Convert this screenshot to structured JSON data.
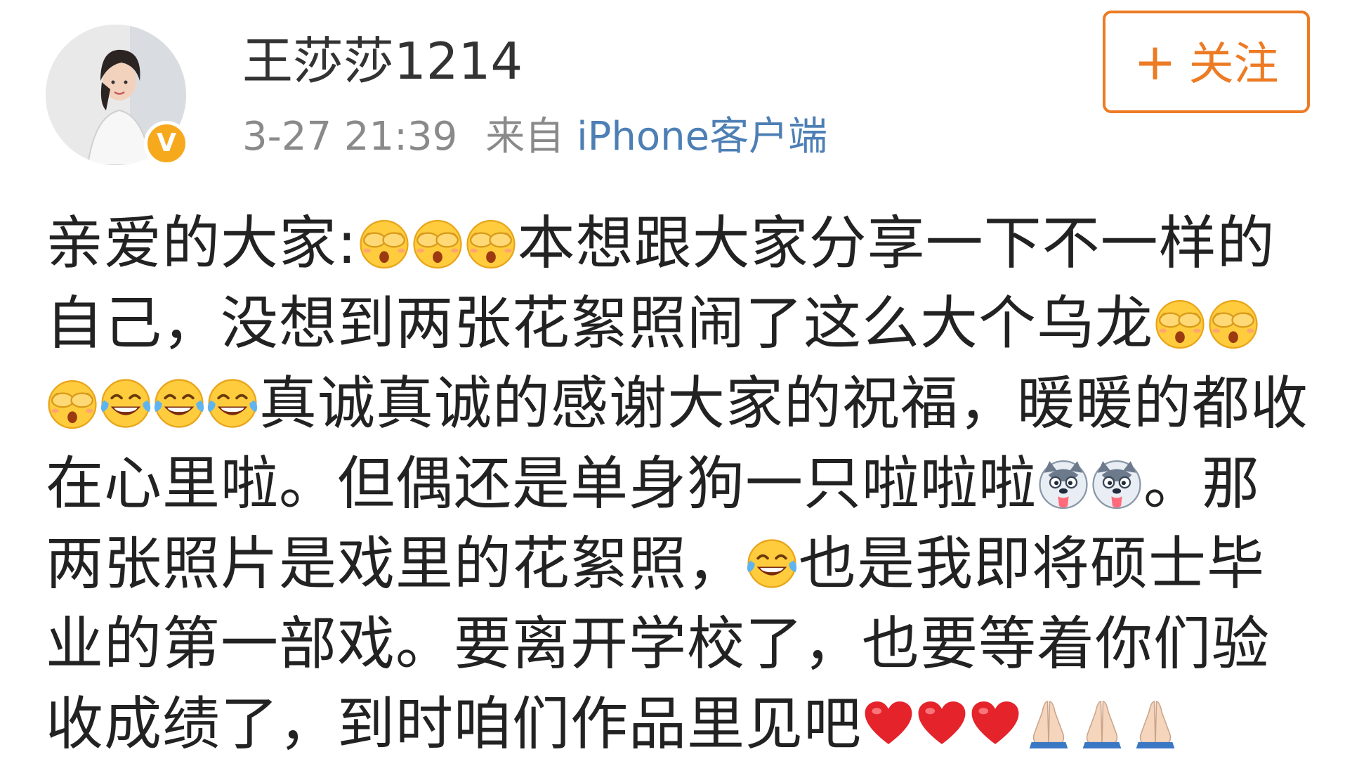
{
  "post": {
    "author": {
      "username": "王莎莎1214",
      "verified_badge": "V",
      "avatar_icon": "avatar-photo"
    },
    "meta": {
      "time": "3-27 21:39",
      "source_prefix": "来自",
      "source": "iPhone客户端"
    },
    "follow_button": {
      "icon": "plus-icon",
      "plus": "+",
      "label": "关注"
    },
    "content": {
      "t1": "亲爱的大家:",
      "t2": "本想跟大家分享一下不一样的自己，没想到两张花絮照闹了这么大个乌龙",
      "t3": "真诚真诚的感谢大家的祝福，暖暖的都收在心里啦。但偶还是单身狗一只啦啦啦",
      "t4": "。那两张照片是戏里的花絮照，",
      "t5": "也是我即将硕士毕业的第一部戏。要离开学校了，也要等着你们验收成绩了，到时咱们作品里见吧"
    },
    "emoji_names": [
      "covering-eyes-emoji",
      "laughing-tears-emoji",
      "husky-dog-emoji",
      "red-heart-emoji",
      "praying-hands-emoji"
    ]
  },
  "colors": {
    "text": "#222222",
    "meta_gray": "#8a8a8a",
    "source_blue": "#4d7fb5",
    "follow_orange": "#ec7b24",
    "badge_yellow": "#f7a91e"
  }
}
